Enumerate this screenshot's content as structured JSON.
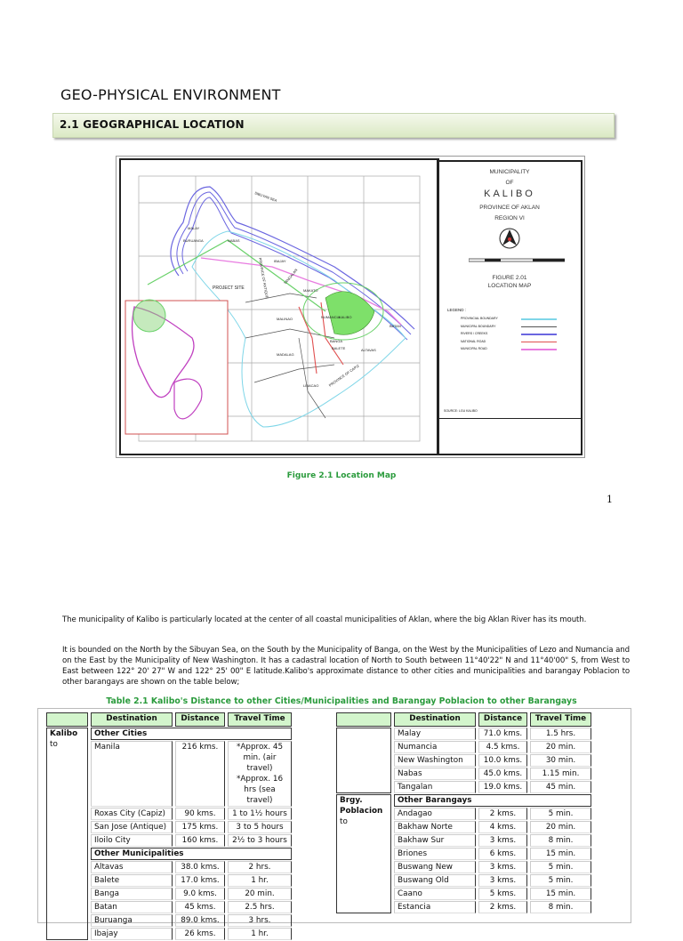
{
  "heading": "GEO-PHYSICAL ENVIRONMENT",
  "section": "2.1   GEOGRAPHICAL LOCATION",
  "map": {
    "title_block": {
      "line1": "MUNICIPALITY",
      "line2": "OF",
      "name": "KALIBO",
      "province": "PROVINCE OF AKLAN",
      "region": "REGION VI",
      "figure": "FIGURE 2.01",
      "figure_title": "LOCATION MAP",
      "legend_label": "LEGEND :",
      "source": "SOURCE: LGU KALIBO"
    },
    "legend": [
      {
        "label": "PROVINCIAL BOUNDARY",
        "color": "#7fd6e8"
      },
      {
        "label": "MUNICIPAL BOUNDARY",
        "color": "#555555"
      },
      {
        "label": "RIVERS / CREEKS",
        "color": "#6b66e0"
      },
      {
        "label": "NATIONAL ROAD",
        "color": "#e05050"
      },
      {
        "label": "MUNICIPAL ROAD",
        "color": "#e87ce0"
      }
    ],
    "labels": {
      "sea": "SIBUYAN SEA",
      "project": "PROJECT SITE",
      "antique": "PROVINCE OF ANTIQUE",
      "capiz": "PROVINCE OF CAPIZ",
      "kalibo": "KALIBO",
      "makato": "MAKATO",
      "malinao": "MALINAO",
      "madalag": "MADALAG",
      "libacao": "LIBACAO",
      "altavas": "ALTAVAS",
      "banga": "BANGA",
      "numancia": "NUMANCIA",
      "balete": "BALETE",
      "batan": "BATAN",
      "nabas": "NABAS",
      "buruanga": "BURUANGA",
      "malay": "MALAY",
      "ibajay": "IBAJAY",
      "tangalan": "TANGALAN"
    }
  },
  "figure_caption": "Figure 2.1 Location Map",
  "page_number": "1",
  "paragraphs": [
    "The municipality of Kalibo is particularly located at the center of all coastal municipalities of Aklan, where the big Aklan River has its mouth.",
    "It is bounded on the North by the Sibuyan Sea, on the South by the Municipality of Banga, on the West by the Municipalities of Lezo and Numancia and on the East by the Municipality of New Washington. It has a cadastral location of North to South between 11°40'22\" N and 11°40'00\" S, from West to East between 122° 20' 27\" W and 122° 25' 00\" E latitude.Kalibo's approximate distance to other cities and municipalities and barangay Poblacion to other barangays are shown on the table below;"
  ],
  "table_caption": "Table 2.1  Kalibo's Distance to other Cities/Municipalities and Barangay Poblacion to other Barangays",
  "table": {
    "headers": [
      "Destination",
      "Distance",
      "Travel Time"
    ],
    "left": {
      "origin_bold": "Kalibo",
      "origin_rest": "to",
      "group1": "Other Cities",
      "cities": [
        {
          "dest": "Manila",
          "dist": "216  kms.",
          "time": "*Approx. 45 min. (air travel) *Approx. 16 hrs (sea travel)"
        },
        {
          "dest": "Roxas City (Capiz)",
          "dist": "90 kms.",
          "time": "1 to 1½ hours"
        },
        {
          "dest": "San Jose (Antique)",
          "dist": "175 kms.",
          "time": "3 to 5 hours"
        },
        {
          "dest": "Iloilo City",
          "dist": "160 kms.",
          "time": "2½ to 3 hours"
        }
      ],
      "group2": "Other Municipalities",
      "municipalities": [
        {
          "dest": "Altavas",
          "dist": "38.0 kms.",
          "time": "2 hrs."
        },
        {
          "dest": "Balete",
          "dist": "17.0 kms.",
          "time": "1 hr."
        },
        {
          "dest": "Banga",
          "dist": "9.0 kms.",
          "time": "20 min."
        },
        {
          "dest": "Batan",
          "dist": "45 kms.",
          "time": "2.5 hrs."
        },
        {
          "dest": "Buruanga",
          "dist": "89.0 kms.",
          "time": "3 hrs."
        },
        {
          "dest": "Ibajay",
          "dist": "26 kms.",
          "time": "1 hr."
        }
      ]
    },
    "right": {
      "municipalities": [
        {
          "dest": "Malay",
          "dist": "71.0 kms.",
          "time": "1.5 hrs."
        },
        {
          "dest": "Numancia",
          "dist": "4.5 kms.",
          "time": "20 min."
        },
        {
          "dest": "New Washington",
          "dist": "10.0 kms.",
          "time": "30 min."
        },
        {
          "dest": "Nabas",
          "dist": "45.0 kms.",
          "time": "1.15 min."
        },
        {
          "dest": "Tangalan",
          "dist": "19.0 kms.",
          "time": "45 min."
        }
      ],
      "origin_bold": "Brgy. Poblacion",
      "origin_rest": "to",
      "group": "Other Barangays",
      "barangays": [
        {
          "dest": "Andagao",
          "dist": "2 kms.",
          "time": "5 min."
        },
        {
          "dest": "Bakhaw Norte",
          "dist": "4 kms.",
          "time": "20 min."
        },
        {
          "dest": "Bakhaw Sur",
          "dist": "3 kms.",
          "time": "8 min."
        },
        {
          "dest": "Briones",
          "dist": "6 kms.",
          "time": "15 min."
        },
        {
          "dest": "Buswang New",
          "dist": "3 kms.",
          "time": "5 min."
        },
        {
          "dest": "Buswang Old",
          "dist": "3 kms.",
          "time": "5 min."
        },
        {
          "dest": "Caano",
          "dist": "5 kms.",
          "time": "15 min."
        },
        {
          "dest": "Estancia",
          "dist": "2 kms.",
          "time": "8 min."
        }
      ]
    }
  }
}
